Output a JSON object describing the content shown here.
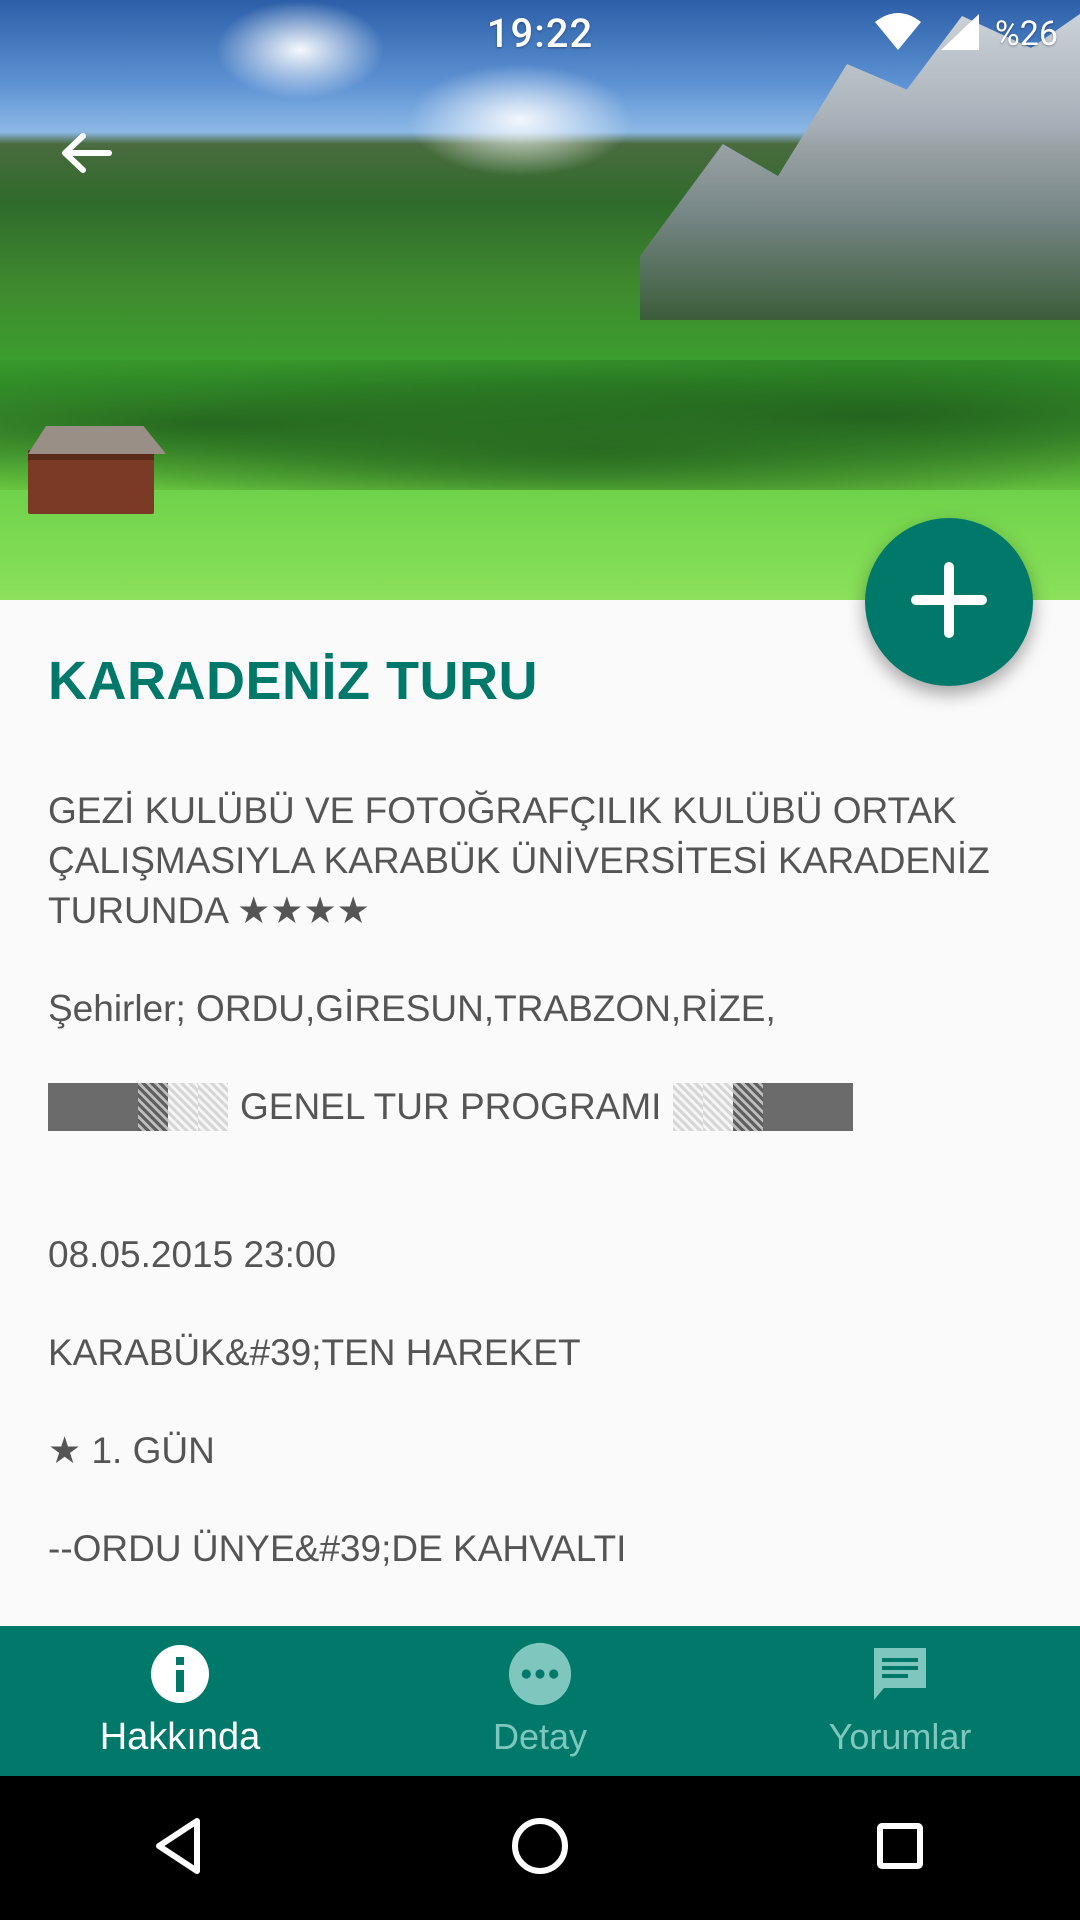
{
  "status_bar": {
    "time": "19:22",
    "battery_text": "%26"
  },
  "header": {
    "back_icon": "arrow-back-icon"
  },
  "fab": {
    "icon": "plus-icon",
    "color": "#00796b"
  },
  "content": {
    "title": "KARADENİZ TURU",
    "intro": "GEZİ KULÜBÜ VE FOTOĞRAFÇILIK KULÜBÜ ORTAK ÇALIŞMASIYLA KARABÜK ÜNİVERSİTESİ KARADENİZ TURUNDA ★★★★",
    "cities": "Şehirler; ORDU,GİRESUN,TRABZON,RİZE,",
    "program_heading": "GENEL TUR PROGRAMI",
    "datetime": "08.05.2015 23:00",
    "departure": "KARABÜK&#39;TEN HAREKET",
    "day1": "★ 1. GÜN",
    "breakfast": "--ORDU ÜNYE&#39;DE KAHVALTI"
  },
  "bottom_nav": {
    "items": [
      {
        "label": "Hakkında",
        "icon": "info-icon",
        "active": true
      },
      {
        "label": "Detay",
        "icon": "more-dots-icon",
        "active": false
      },
      {
        "label": "Yorumlar",
        "icon": "comment-icon",
        "active": false
      }
    ]
  },
  "android_nav": {
    "back_icon": "nav-back-icon",
    "home_icon": "nav-home-icon",
    "recents_icon": "nav-recents-icon"
  }
}
